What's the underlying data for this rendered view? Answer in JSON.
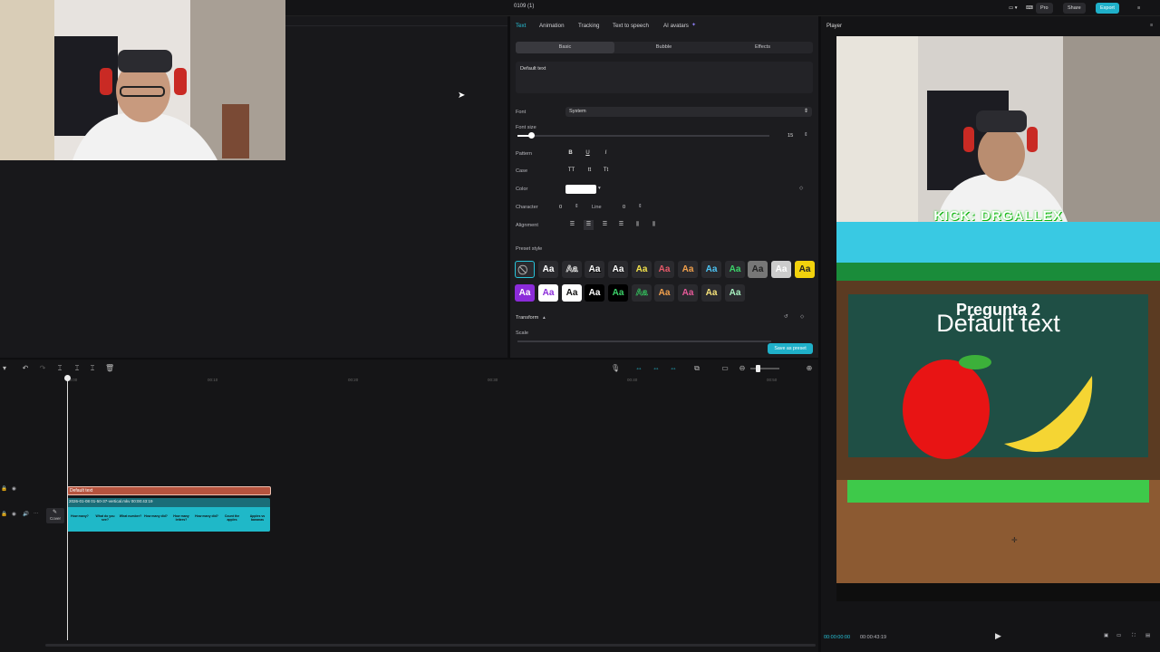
{
  "window": {
    "title": "0109 (1)"
  },
  "topbar": {
    "pro_label": "Pro",
    "share_label": "Share",
    "export_label": "Export"
  },
  "text_panel": {
    "tabs": [
      "Text",
      "Animation",
      "Tracking",
      "Text to speech",
      "AI avatars"
    ],
    "subtabs": [
      "Basic",
      "Bubble",
      "Effects"
    ],
    "text_content": "Default text",
    "font_label": "Font",
    "font_value": "System",
    "font_size_label": "Font size",
    "font_size_value": "15",
    "font_size_fraction": 0.03,
    "pattern_label": "Pattern",
    "pattern_buttons": [
      "B",
      "U",
      "I"
    ],
    "case_label": "Case",
    "case_buttons": [
      "TT",
      "tt",
      "Tt"
    ],
    "color_label": "Color",
    "color_value": "#ffffff",
    "character_label": "Character",
    "character_value": "0",
    "line_label": "Line",
    "line_value": "0",
    "alignment_label": "Alignment",
    "preset_style_label": "Preset style",
    "preset_sample": "Aa",
    "transform_label": "Transform",
    "scale_label": "Scale",
    "save_preset_label": "Save as preset"
  },
  "player": {
    "title": "Player",
    "overlay_banner": "KICK: DRGALLEX",
    "question_text": "Pregunta 2",
    "default_text": "Default text",
    "current_time": "00:00:00:00",
    "total_time": "00:00:43:19"
  },
  "timeline": {
    "ruler_labels": [
      "00:00",
      "00:10",
      "00:20",
      "00:30",
      "00:40",
      "00:50"
    ],
    "text_clip_label": "Default text",
    "video_clip_label": "2026-01-08 01-50-37-vertical.mkv  00:00:43:19",
    "cover_label": "Cover",
    "thumb_labels": [
      "How many?",
      "What do you see?",
      "What number?",
      "How many did?",
      "How many letters?",
      "How many did?",
      "Count the apples",
      "Apples vs bananas"
    ]
  }
}
